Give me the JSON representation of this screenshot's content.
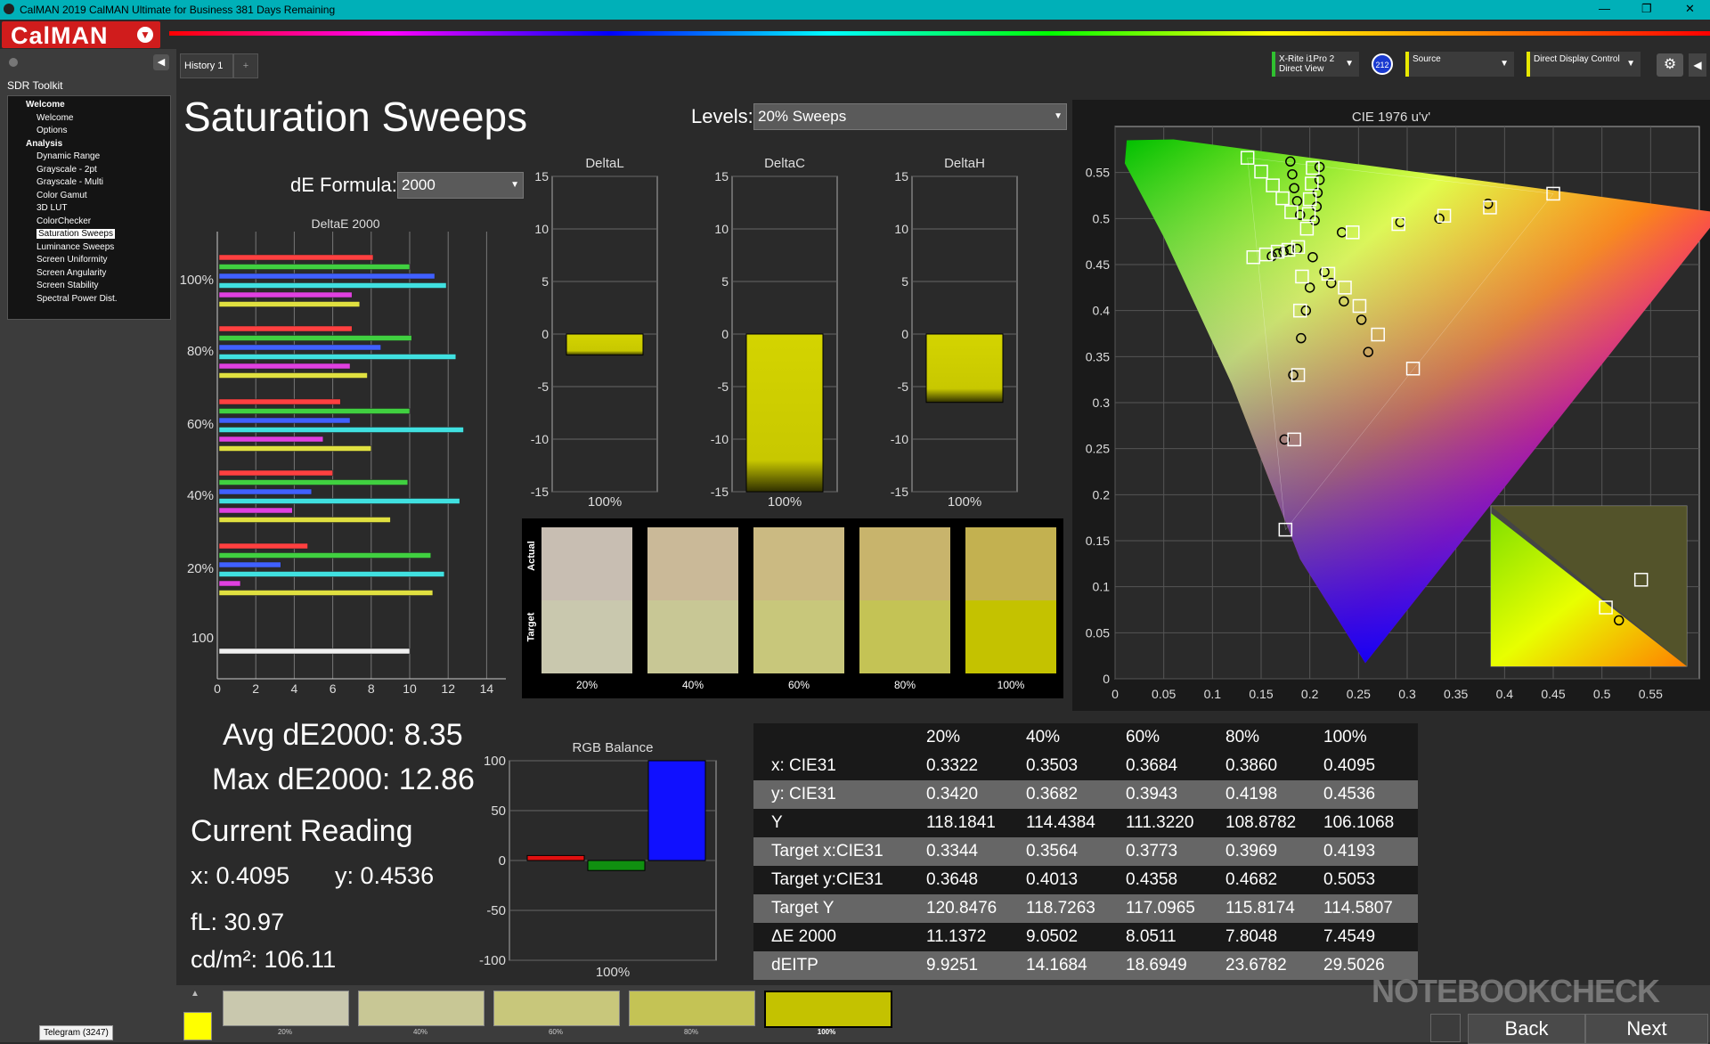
{
  "window": {
    "title": "CalMAN 2019 CalMAN Ultimate for Business 381 Days Remaining",
    "icon": "calman-app-icon"
  },
  "app": {
    "logo": "CalMAN"
  },
  "sidebar": {
    "title": "SDR Toolkit",
    "items": [
      {
        "label": "Welcome",
        "type": "header"
      },
      {
        "label": "Welcome",
        "type": "item"
      },
      {
        "label": "Options",
        "type": "item"
      },
      {
        "label": "Analysis",
        "type": "header"
      },
      {
        "label": "Dynamic Range",
        "type": "item"
      },
      {
        "label": "Grayscale - 2pt",
        "type": "item"
      },
      {
        "label": "Grayscale - Multi",
        "type": "item"
      },
      {
        "label": "Color Gamut",
        "type": "item"
      },
      {
        "label": "3D LUT",
        "type": "item"
      },
      {
        "label": "ColorChecker",
        "type": "item"
      },
      {
        "label": "Saturation Sweeps",
        "type": "item",
        "selected": true
      },
      {
        "label": "Luminance Sweeps",
        "type": "item"
      },
      {
        "label": "Screen Uniformity",
        "type": "item"
      },
      {
        "label": "Screen Angularity",
        "type": "item"
      },
      {
        "label": "Screen Stability",
        "type": "item"
      },
      {
        "label": "Spectral Power Dist.",
        "type": "item"
      }
    ],
    "taskbar_badge": "Telegram (3247)"
  },
  "tabs": {
    "history": "History 1"
  },
  "devices": {
    "meter_line1": "X-Rite i1Pro 2",
    "meter_line2": "Direct View",
    "meter_badge": "212",
    "source": "Source",
    "display": "Direct Display Control"
  },
  "page": {
    "title": "Saturation Sweeps",
    "levels_label": "Levels:",
    "levels_value": "20% Sweeps",
    "de_formula_label": "dE Formula:",
    "de_formula_value": "2000"
  },
  "stats": {
    "avg": "Avg dE2000: 8.35",
    "max": "Max dE2000: 12.86",
    "current_reading": "Current Reading",
    "x": "x: 0.4095",
    "y": "y: 0.4536",
    "fl": "fL: 30.97",
    "cdm2": "cd/m²: 106.11"
  },
  "chart_data": [
    {
      "type": "bar",
      "title": "DeltaE 2000",
      "orientation": "horizontal",
      "xlim": [
        0,
        15
      ],
      "x_ticks": [
        "0",
        "2",
        "4",
        "6",
        "8",
        "10",
        "12",
        "14"
      ],
      "groups": [
        "100%",
        "80%",
        "60%",
        "40%",
        "20%",
        "100"
      ],
      "series_colors": [
        "#ff4040",
        "#40d040",
        "#4060ff",
        "#40e0e0",
        "#e040e0",
        "#e0e040"
      ],
      "values": {
        "100%": [
          8.1,
          10.0,
          11.3,
          11.9,
          7.0,
          7.4
        ],
        "80%": [
          7.0,
          10.1,
          8.5,
          12.4,
          6.9,
          7.8
        ],
        "60%": [
          6.4,
          10.0,
          6.9,
          12.8,
          5.5,
          8.0
        ],
        "40%": [
          6.0,
          9.9,
          4.9,
          12.6,
          3.9,
          9.0
        ],
        "20%": [
          4.7,
          11.1,
          3.3,
          11.8,
          1.2,
          11.2
        ],
        "100": [
          10.0
        ]
      }
    },
    {
      "type": "bar",
      "title": "DeltaL",
      "categories": [
        "100%"
      ],
      "values": [
        -2
      ],
      "ylim": [
        -15,
        15
      ],
      "y_ticks": [
        "15",
        "10",
        "5",
        "0",
        "-5",
        "-10",
        "-15"
      ]
    },
    {
      "type": "bar",
      "title": "DeltaC",
      "categories": [
        "100%"
      ],
      "values": [
        -15
      ],
      "ylim": [
        -15,
        15
      ],
      "y_ticks": [
        "15",
        "10",
        "5",
        "0",
        "-5",
        "-10",
        "-15"
      ]
    },
    {
      "type": "bar",
      "title": "DeltaH",
      "categories": [
        "100%"
      ],
      "values": [
        -6.5
      ],
      "ylim": [
        -15,
        15
      ],
      "y_ticks": [
        "15",
        "10",
        "5",
        "0",
        "-5",
        "-10",
        "-15"
      ]
    },
    {
      "type": "bar",
      "title": "RGB Balance",
      "categories": [
        "100%"
      ],
      "series": [
        {
          "name": "R",
          "values": [
            5
          ],
          "color": "#e01010"
        },
        {
          "name": "G",
          "values": [
            -10
          ],
          "color": "#109010"
        },
        {
          "name": "B",
          "values": [
            100
          ],
          "color": "#1010ff"
        }
      ],
      "ylim": [
        -100,
        100
      ],
      "y_ticks": [
        "100",
        "50",
        "0",
        "-50",
        "-100"
      ]
    },
    {
      "type": "scatter",
      "title": "CIE 1976 u'v'",
      "xlim": [
        0,
        0.6
      ],
      "ylim": [
        0,
        0.6
      ],
      "x_ticks": [
        "0",
        "0.05",
        "0.1",
        "0.15",
        "0.2",
        "0.25",
        "0.3",
        "0.35",
        "0.4",
        "0.45",
        "0.5",
        "0.55"
      ],
      "y_ticks": [
        "0",
        "0.05",
        "0.1",
        "0.15",
        "0.2",
        "0.25",
        "0.3",
        "0.35",
        "0.4",
        "0.45",
        "0.5",
        "0.55"
      ],
      "targets": [
        [
          0.45,
          0.527
        ],
        [
          0.385,
          0.512
        ],
        [
          0.338,
          0.503
        ],
        [
          0.291,
          0.494
        ],
        [
          0.244,
          0.485
        ],
        [
          0.136,
          0.566
        ],
        [
          0.15,
          0.551
        ],
        [
          0.162,
          0.536
        ],
        [
          0.172,
          0.522
        ],
        [
          0.181,
          0.507
        ],
        [
          0.203,
          0.555
        ],
        [
          0.202,
          0.538
        ],
        [
          0.2,
          0.521
        ],
        [
          0.199,
          0.505
        ],
        [
          0.197,
          0.489
        ],
        [
          0.142,
          0.458
        ],
        [
          0.155,
          0.461
        ],
        [
          0.167,
          0.464
        ],
        [
          0.178,
          0.466
        ],
        [
          0.188,
          0.469
        ],
        [
          0.175,
          0.162
        ],
        [
          0.184,
          0.26
        ],
        [
          0.188,
          0.33
        ],
        [
          0.19,
          0.4
        ],
        [
          0.192,
          0.437
        ],
        [
          0.306,
          0.337
        ],
        [
          0.27,
          0.374
        ],
        [
          0.251,
          0.405
        ],
        [
          0.236,
          0.425
        ],
        [
          0.219,
          0.44
        ]
      ],
      "measured": [
        [
          0.383,
          0.516
        ],
        [
          0.333,
          0.5
        ],
        [
          0.293,
          0.496
        ],
        [
          0.233,
          0.485
        ],
        [
          0.18,
          0.562
        ],
        [
          0.182,
          0.548
        ],
        [
          0.184,
          0.533
        ],
        [
          0.187,
          0.519
        ],
        [
          0.19,
          0.504
        ],
        [
          0.21,
          0.556
        ],
        [
          0.21,
          0.542
        ],
        [
          0.208,
          0.528
        ],
        [
          0.207,
          0.513
        ],
        [
          0.205,
          0.498
        ],
        [
          0.161,
          0.459
        ],
        [
          0.167,
          0.462
        ],
        [
          0.173,
          0.464
        ],
        [
          0.18,
          0.466
        ],
        [
          0.187,
          0.467
        ],
        [
          0.174,
          0.26
        ],
        [
          0.183,
          0.33
        ],
        [
          0.191,
          0.37
        ],
        [
          0.196,
          0.4
        ],
        [
          0.2,
          0.425
        ],
        [
          0.26,
          0.355
        ],
        [
          0.253,
          0.39
        ],
        [
          0.235,
          0.41
        ],
        [
          0.222,
          0.43
        ],
        [
          0.215,
          0.442
        ],
        [
          0.203,
          0.458
        ]
      ],
      "inset_target": [
        [
          0.115,
          0.081
        ],
        [
          0.088,
          0.055
        ]
      ],
      "inset_measured": [
        [
          0.098,
          0.043
        ]
      ]
    }
  ],
  "swatches": {
    "actual_label": "Actual",
    "target_label": "Target",
    "items": [
      {
        "label": "20%",
        "actual": "#c8beb2",
        "target": "#c9c8ae"
      },
      {
        "label": "40%",
        "actual": "#cab998",
        "target": "#c8c795"
      },
      {
        "label": "60%",
        "actual": "#cbba82",
        "target": "#c8c77b"
      },
      {
        "label": "80%",
        "actual": "#c8b46c",
        "target": "#c4c355"
      },
      {
        "label": "100%",
        "actual": "#c3b150",
        "target": "#c4c200"
      }
    ]
  },
  "table": {
    "columns": [
      "",
      "20%",
      "40%",
      "60%",
      "80%",
      "100%"
    ],
    "rows": [
      {
        "label": "x: CIE31",
        "vals": [
          "0.3322",
          "0.3503",
          "0.3684",
          "0.3860",
          "0.4095"
        ]
      },
      {
        "label": "y: CIE31",
        "vals": [
          "0.3420",
          "0.3682",
          "0.3943",
          "0.4198",
          "0.4536"
        ]
      },
      {
        "label": "Y",
        "vals": [
          "118.1841",
          "114.4384",
          "111.3220",
          "108.8782",
          "106.1068"
        ]
      },
      {
        "label": "Target x:CIE31",
        "vals": [
          "0.3344",
          "0.3564",
          "0.3773",
          "0.3969",
          "0.4193"
        ]
      },
      {
        "label": "Target y:CIE31",
        "vals": [
          "0.3648",
          "0.4013",
          "0.4358",
          "0.4682",
          "0.5053"
        ]
      },
      {
        "label": "Target Y",
        "vals": [
          "120.8476",
          "118.7263",
          "117.0965",
          "115.8174",
          "114.5807"
        ]
      },
      {
        "label": "ΔE 2000",
        "vals": [
          "11.1372",
          "9.0502",
          "8.0511",
          "7.8048",
          "7.4549"
        ]
      },
      {
        "label": "dEITP",
        "vals": [
          "9.9251",
          "14.1684",
          "18.6949",
          "23.6782",
          "29.5026"
        ]
      }
    ]
  },
  "bottom": {
    "swatch_labels": [
      "20%",
      "40%",
      "60%",
      "80%",
      "100%"
    ],
    "swatch_colors": [
      "#c9c8ae",
      "#c8c795",
      "#c8c77b",
      "#c4c355",
      "#c4c200"
    ],
    "current_color": "#ffff00",
    "back": "Back",
    "next": "Next",
    "watermark": "NOTEBOOKCHECK"
  }
}
